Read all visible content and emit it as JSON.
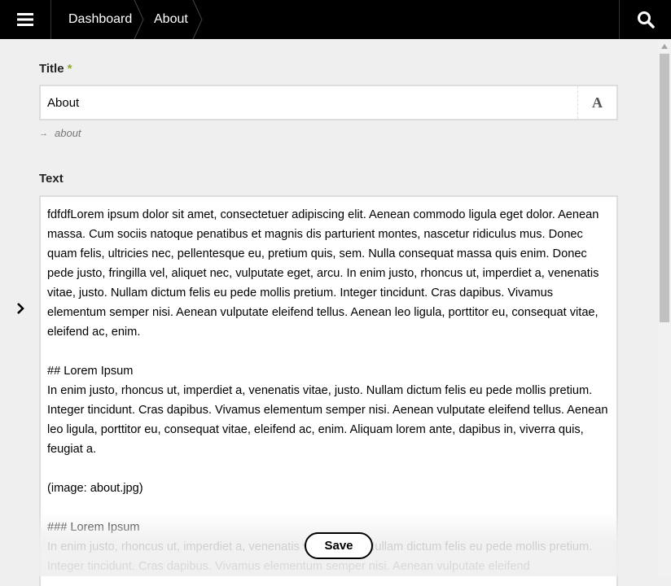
{
  "header": {
    "menu_icon": "hamburger-menu-icon",
    "breadcrumbs": [
      {
        "label": "Dashboard"
      },
      {
        "label": "About"
      }
    ],
    "search_icon": "search-icon"
  },
  "form": {
    "title_field": {
      "label": "Title",
      "required_mark": "*",
      "value": "About",
      "button_icon": "text-format-icon",
      "button_glyph": "A"
    },
    "slug": {
      "arrow": "→",
      "value": "about"
    },
    "text_field": {
      "label": "Text",
      "value": "fdfdfLorem ipsum dolor sit amet, consectetuer adipiscing elit. Aenean commodo ligula eget dolor. Aenean massa. Cum sociis natoque penatibus et magnis dis parturient montes, nascetur ridiculus mus. Donec quam felis, ultricies nec, pellentesque eu, pretium quis, sem. Nulla consequat massa quis enim. Donec pede justo, fringilla vel, aliquet nec, vulputate eget, arcu. In enim justo, rhoncus ut, imperdiet a, venenatis vitae, justo. Nullam dictum felis eu pede mollis pretium. Integer tincidunt. Cras dapibus. Vivamus elementum semper nisi. Aenean vulputate eleifend tellus. Aenean leo ligula, porttitor eu, consequat vitae, eleifend ac, enim.\n\n## Lorem Ipsum\nIn enim justo, rhoncus ut, imperdiet a, venenatis vitae, justo. Nullam dictum felis eu pede mollis pretium. Integer tincidunt. Cras dapibus. Vivamus elementum semper nisi. Aenean vulputate eleifend tellus. Aenean leo ligula, porttitor eu, consequat vitae, eleifend ac, enim. Aliquam lorem ante, dapibus in, viverra quis, feugiat a.\n\n(image: about.jpg)\n\n### Lorem Ipsum\nIn enim justo, rhoncus ut, imperdiet a, venenatis vitae, justo. Nullam dictum felis eu pede mollis pretium. Integer tincidunt. Cras dapibus. Vivamus elementum semper nisi. Aenean vulputate eleifend"
    },
    "save_label": "Save"
  },
  "sidebar_toggle_icon": "chevron-right-icon",
  "colors": {
    "topbar": "#000000",
    "background": "#efefef",
    "required": "#8dae28"
  }
}
